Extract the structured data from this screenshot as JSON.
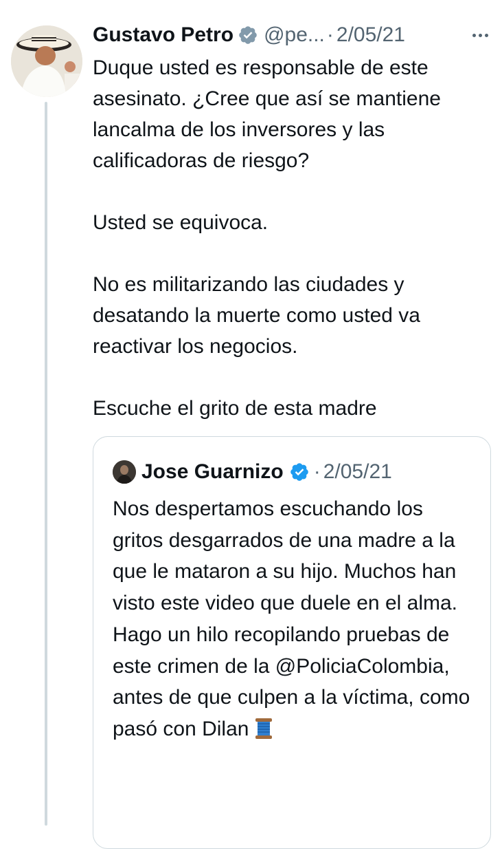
{
  "tweet": {
    "author_name": "Gustavo Petro",
    "handle": "@pe...",
    "separator": "·",
    "date": "2/05/21",
    "paragraphs": [
      "Duque usted es responsable de este asesinato. ¿Cree que así se mantiene lancalma de los inversores y las calificadoras de riesgo?",
      "Usted se equivoca.",
      "No es militarizando las ciudades y desatando la muerte como usted va reactivar los negocios.",
      "Escuche el grito de esta madre"
    ]
  },
  "quoted_tweet": {
    "author_name": "Jose Guarnizo",
    "separator": "·",
    "date": "2/05/21",
    "text": "Nos despertamos escuchando los gritos desgarrados de una madre a la que le mataron a su hijo. Muchos han visto este video que duele en el alma. Hago un hilo recopilando pruebas de este crimen de la @PoliciaColombia, antes de que culpen a la víctima, como pasó con Dilan",
    "trailing_emoji": "spool-of-thread"
  },
  "colors": {
    "text_primary": "#0f1419",
    "text_secondary": "#536471",
    "border": "#cfd9de",
    "verified_gray": "#829aab",
    "verified_blue": "#1d9bf0"
  },
  "icons": {
    "author_verified": "verified-badge-gray-icon",
    "quoted_verified": "verified-badge-blue-icon",
    "more": "more-options-icon"
  }
}
